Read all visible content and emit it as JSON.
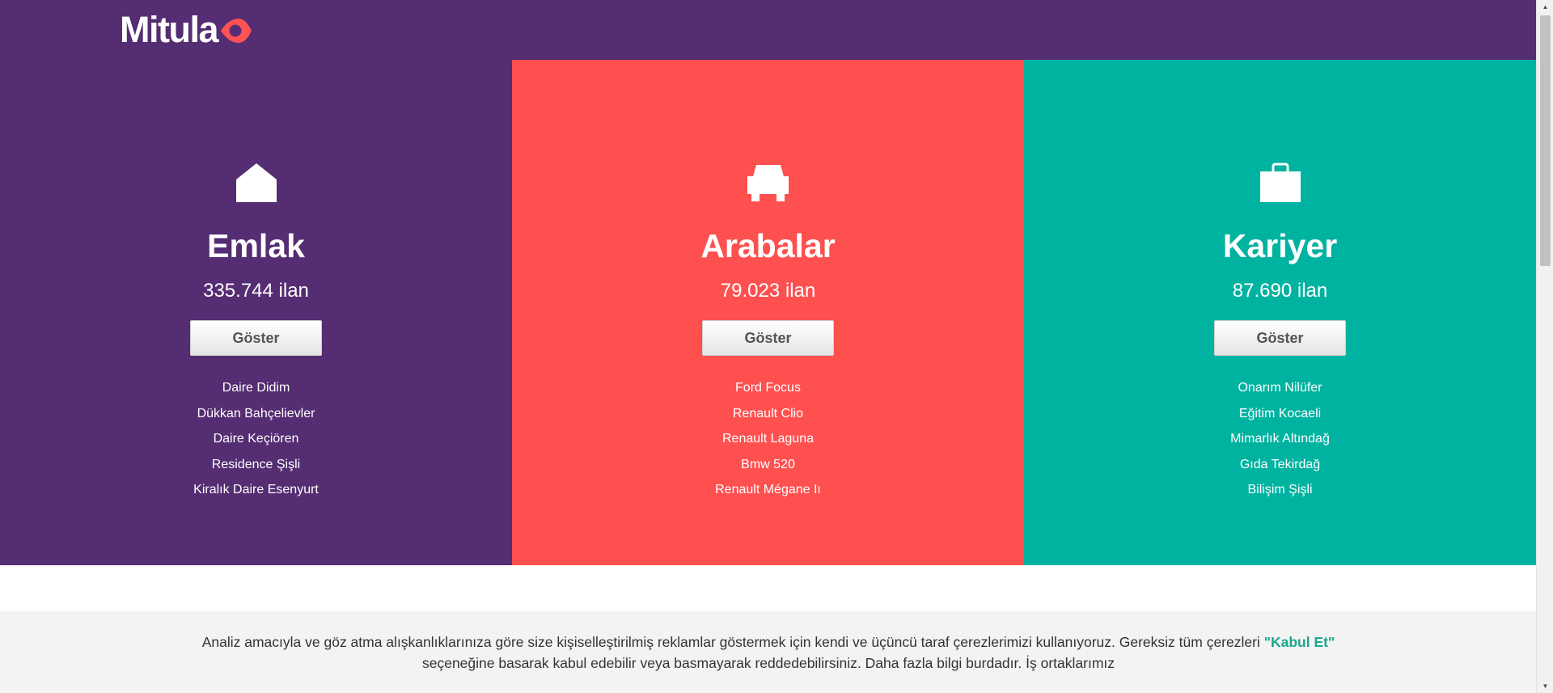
{
  "brand": {
    "name": "Mitula",
    "accent": "#ff5252",
    "header_bg": "#552d72"
  },
  "sections": [
    {
      "icon": "house-icon",
      "bg": "#552d72",
      "title": "Emlak",
      "count": "335.744 ilan",
      "button": "Göster",
      "links": [
        "Daire Didim",
        "Dükkan Bahçelievler",
        "Daire Keçiören",
        "Residence Şişli",
        "Kiralık Daire Esenyurt"
      ]
    },
    {
      "icon": "car-icon",
      "bg": "#ff5050",
      "title": "Arabalar",
      "count": "79.023 ilan",
      "button": "Göster",
      "links": [
        "Ford Focus",
        "Renault Clio",
        "Renault Laguna",
        "Bmw 520",
        "Renault Mégane Iı"
      ]
    },
    {
      "icon": "briefcase-icon",
      "bg": "#00b3a0",
      "title": "Kariyer",
      "count": "87.690 ilan",
      "button": "Göster",
      "links": [
        "Onarım Nilüfer",
        "Eğitim Kocaeli",
        "Mimarlık Altındağ",
        "Gıda Tekirdağ",
        "Bilişim Şişli"
      ]
    }
  ],
  "cookie": {
    "text_before": "Analiz amacıyla ve göz atma alışkanlıklarınıza göre size kişiselleştirilmiş reklamlar göstermek için kendi ve üçüncü taraf çerezlerimizi kullanıyoruz. Gereksiz tüm çerezleri ",
    "accept_label": "\"Kabul Et\"",
    "text_after": "seçeneğine basarak kabul edebilir veya basmayarak reddedebilirsiniz. Daha fazla bilgi ",
    "more_link": "burdadır.",
    "partners_link": "İş ortaklarımız",
    "accent": "#1aa68f"
  }
}
